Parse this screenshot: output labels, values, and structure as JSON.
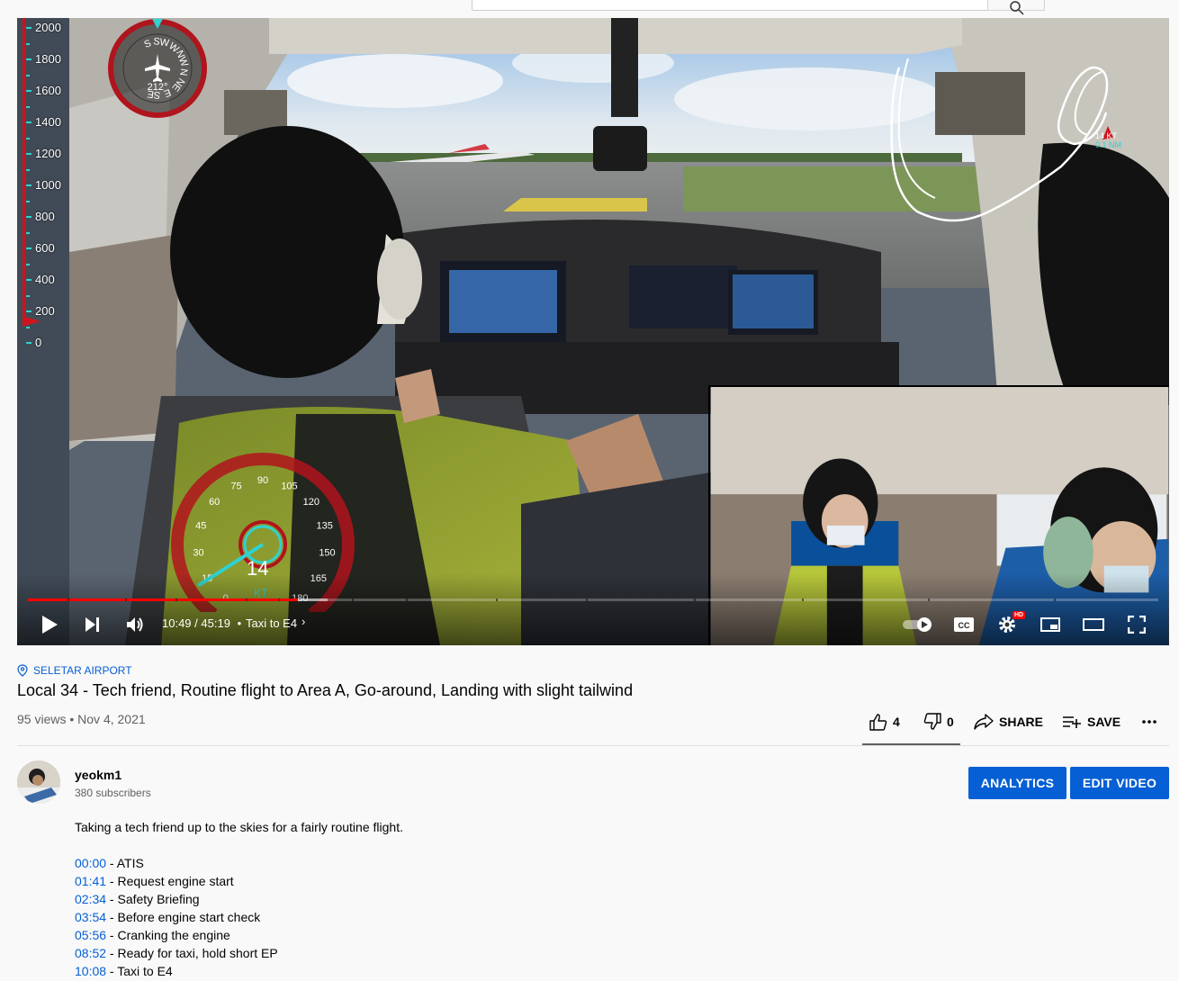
{
  "masthead": {
    "search_placeholder": ""
  },
  "player": {
    "altitude_labels": [
      "2000",
      "1800",
      "1600",
      "1400",
      "1200",
      "1000",
      "800",
      "600",
      "400",
      "200",
      "0"
    ],
    "compass": {
      "labels": [
        "S",
        "SW",
        "W",
        "NW",
        "N",
        "NE",
        "E",
        "SE"
      ],
      "heading": "212°"
    },
    "track": {
      "speed": "14 KT",
      "distance": "0.1 NM"
    },
    "speedometer": {
      "labels": [
        "0",
        "15",
        "30",
        "45",
        "60",
        "75",
        "90",
        "105",
        "120",
        "135",
        "150",
        "165",
        "180"
      ],
      "value": "14",
      "unit": "KT"
    },
    "time_current": "10:49",
    "time_separator": "/",
    "time_total": "45:19",
    "chapter_bullet": "•",
    "chapter_title": "Taxi to E4",
    "chapter_chevron": "›",
    "progress_played_fraction": 0.239,
    "progress_loaded_fraction": 0.265,
    "hd_badge": "HD",
    "colors": {
      "progress_red": "#ff0000",
      "hud_cyan": "#2fd2d0",
      "hud_red": "#c8141e"
    }
  },
  "video": {
    "location": "SELETAR AIRPORT",
    "title": "Local 34 - Tech friend, Routine flight to Area A, Go-around, Landing with slight tailwind",
    "views": "95 views",
    "meta_separator": "•",
    "date": "Nov 4, 2021",
    "likes": "4",
    "dislikes": "0",
    "share_label": "SHARE",
    "save_label": "SAVE",
    "more_icon": "more-horizontal-icon"
  },
  "channel": {
    "name": "yeokm1",
    "subscribers": "380 subscribers",
    "analytics_label": "ANALYTICS",
    "edit_label": "EDIT VIDEO"
  },
  "description": {
    "text": "Taking a tech friend up to the skies for a fairly routine flight.",
    "chapters": [
      {
        "time": "00:00",
        "label": " - ATIS"
      },
      {
        "time": "01:41",
        "label": " - Request engine start"
      },
      {
        "time": "02:34",
        "label": " - Safety Briefing"
      },
      {
        "time": "03:54",
        "label": " - Before engine start check"
      },
      {
        "time": "05:56",
        "label": " - Cranking the engine"
      },
      {
        "time": "08:52",
        "label": " - Ready for taxi, hold short EP"
      },
      {
        "time": "10:08",
        "label": " - Taxi to E4"
      }
    ]
  }
}
